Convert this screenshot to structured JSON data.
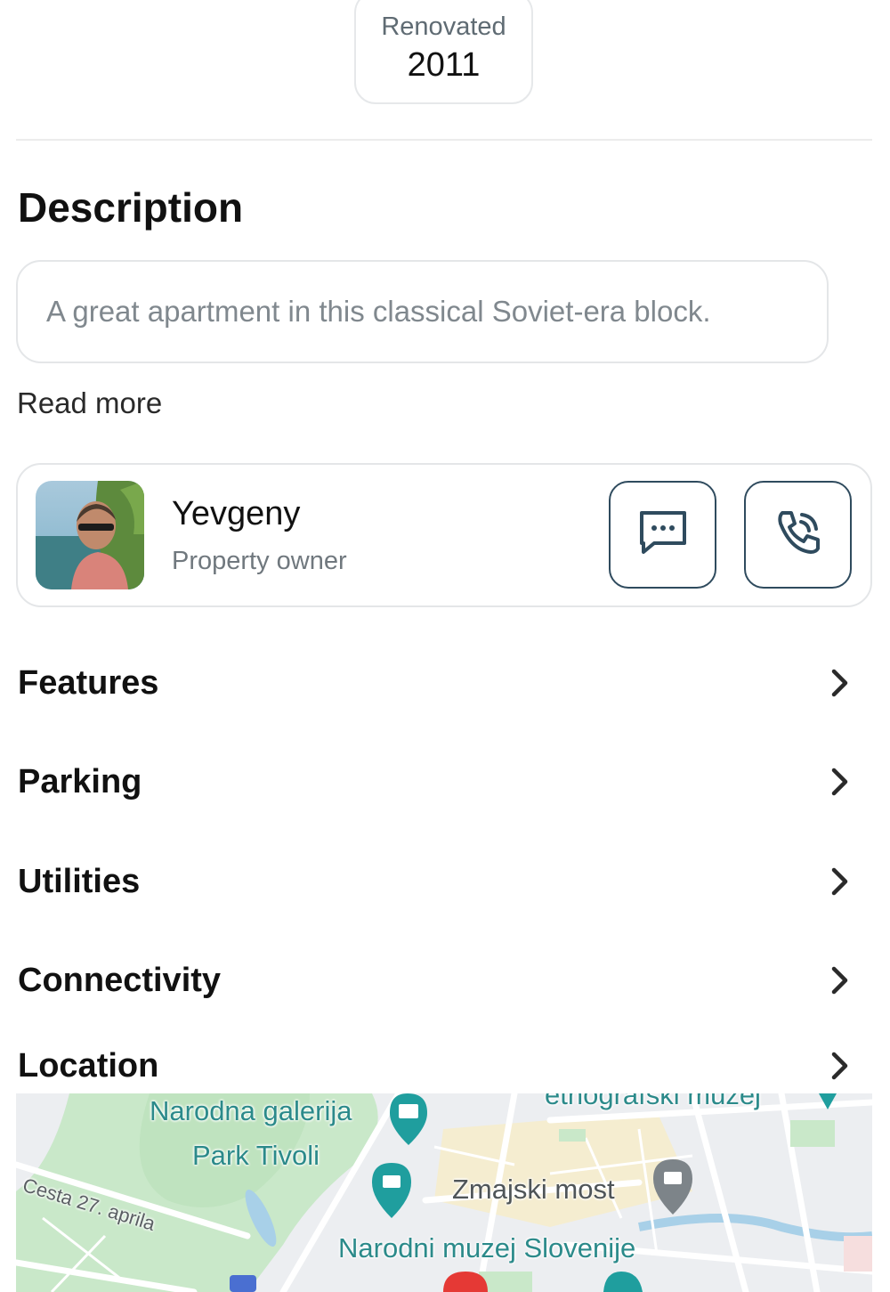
{
  "stat": {
    "label": "Renovated",
    "value": "2011"
  },
  "description": {
    "title": "Description",
    "text": "A great apartment in this classical Soviet-era block.",
    "read_more": "Read more"
  },
  "owner": {
    "name": "Yevgeny",
    "role": "Property owner"
  },
  "sections": [
    {
      "label": "Features"
    },
    {
      "label": "Parking"
    },
    {
      "label": "Utilities"
    },
    {
      "label": "Connectivity"
    },
    {
      "label": "Location"
    }
  ],
  "map": {
    "labels": {
      "gallery": "Narodna galerija",
      "park": "Park Tivoli",
      "bridge": "Zmajski most",
      "museum": "Narodni muzej Slovenije",
      "ethno": "etnografski muzej",
      "street": "Cesta 27. aprila"
    }
  },
  "colors": {
    "button_border": "#2f4b5e",
    "map_label": "#2b8a8a",
    "map_park": "#c9e8c9",
    "map_pin": "#1f9e9e"
  }
}
